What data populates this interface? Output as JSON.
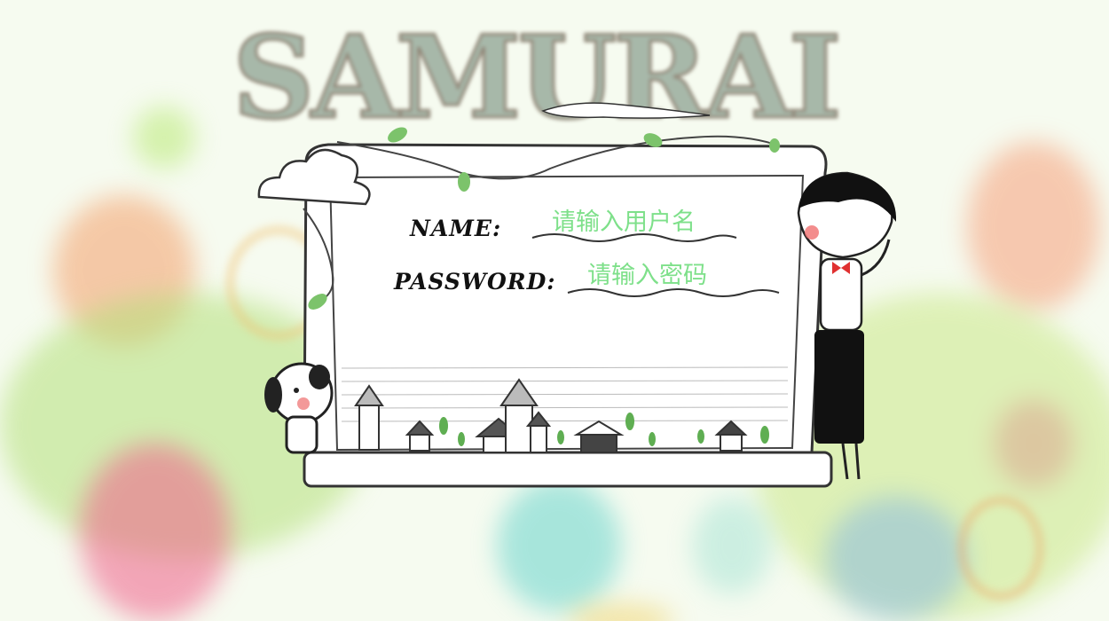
{
  "app": {
    "title_text": "SAMURAI",
    "accent_placeholder_color": "#7ee08a"
  },
  "login_form": {
    "name_label": "NAME:",
    "name_placeholder": "请输入用户名",
    "password_label": "PASSWORD:",
    "password_placeholder": "请输入密码"
  },
  "decorations": {
    "icons": [
      "cloud-icon",
      "boy-character-icon",
      "dog-character-icon",
      "house-icon",
      "leaf-icon",
      "tree-sprout-icon"
    ]
  }
}
